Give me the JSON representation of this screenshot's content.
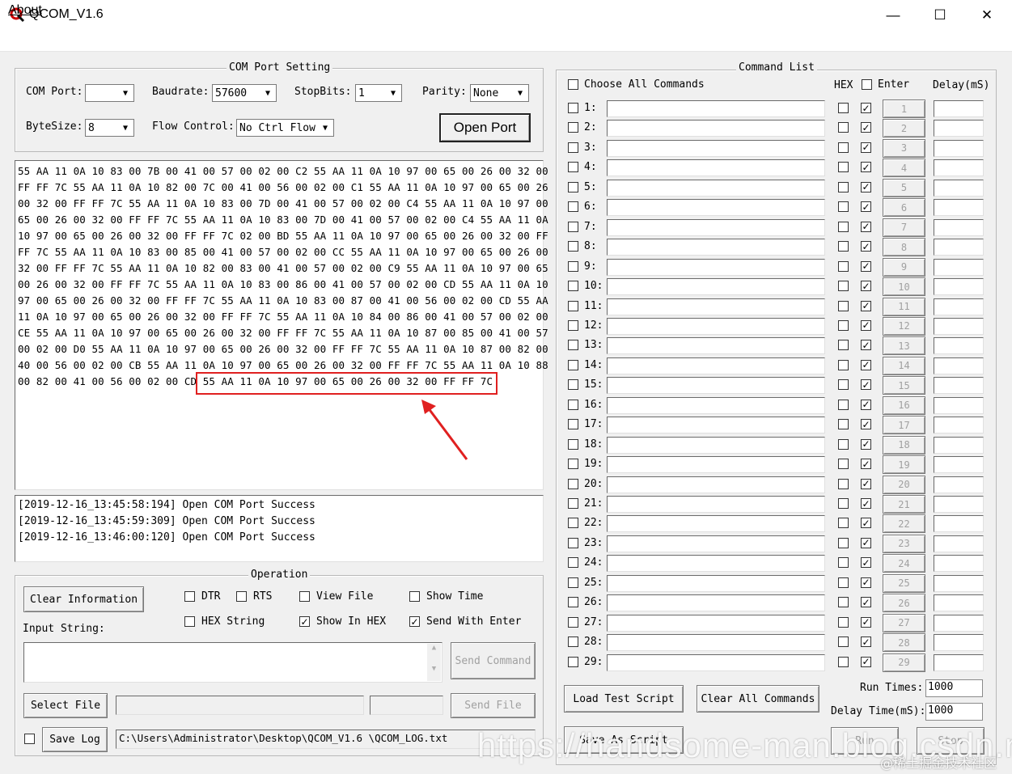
{
  "window": {
    "title": "QCOM_V1.6",
    "minimize": "—",
    "maximize": "☐",
    "close": "✕"
  },
  "menu": {
    "about": "About"
  },
  "com_setting": {
    "title": "COM Port Setting",
    "com_port_label": "COM Port:",
    "com_port_value": "",
    "baudrate_label": "Baudrate:",
    "baudrate_value": "57600",
    "stopbits_label": "StopBits:",
    "stopbits_value": "1",
    "parity_label": "Parity:",
    "parity_value": "None",
    "bytesize_label": "ByteSize:",
    "bytesize_value": "8",
    "flow_label": "Flow Control:",
    "flow_value": "No Ctrl Flow",
    "open_port": "Open Port"
  },
  "receive_lines": [
    "55 AA 11 0A 10 83 00 7B 00 41 00 57 00 02 00 C2 55 AA 11 0A 10 97 00 65 00 26 00 32 00",
    "FF FF 7C 55 AA 11 0A 10 82 00 7C 00 41 00 56 00 02 00 C1 55 AA 11 0A 10 97 00 65 00 26",
    "00 32 00 FF FF 7C 55 AA 11 0A 10 83 00 7D 00 41 00 57 00 02 00 C4 55 AA 11 0A 10 97 00",
    "65 00 26 00 32 00 FF FF 7C 55 AA 11 0A 10 83 00 7D 00 41 00 57 00 02 00 C4 55 AA 11 0A",
    "10 97 00 65 00 26 00 32 00 FF FF 7C 02 00 BD 55 AA 11 0A 10 97 00 65 00 26 00 32 00 FF",
    "FF 7C 55 AA 11 0A 10 83 00 85 00 41 00 57 00 02 00 CC 55 AA 11 0A 10 97 00 65 00 26 00",
    "32 00 FF FF 7C 55 AA 11 0A 10 82 00 83 00 41 00 57 00 02 00 C9 55 AA 11 0A 10 97 00 65",
    "00 26 00 32 00 FF FF 7C 55 AA 11 0A 10 83 00 86 00 41 00 57 00 02 00 CD 55 AA 11 0A 10",
    "97 00 65 00 26 00 32 00 FF FF 7C 55 AA 11 0A 10 83 00 87 00 41 00 56 00 02 00 CD 55 AA",
    "11 0A 10 97 00 65 00 26 00 32 00 FF FF 7C 55 AA 11 0A 10 84 00 86 00 41 00 57 00 02 00",
    "CE 55 AA 11 0A 10 97 00 65 00 26 00 32 00 FF FF 7C 55 AA 11 0A 10 87 00 85 00 41 00 57",
    "00 02 00 D0 55 AA 11 0A 10 97 00 65 00 26 00 32 00 FF FF 7C 55 AA 11 0A 10 87 00 82 00",
    "40 00 56 00 02 00 CB 55 AA 11 0A 10 97 00 65 00 26 00 32 00 FF FF 7C 55 AA 11 0A 10 88",
    "00 82 00 41 00 56 00 02 00 CD 55 AA 11 0A 10 97 00 65 00 26 00 32 00 FF FF 7C"
  ],
  "log_lines": [
    "[2019-12-16_13:45:58:194] Open COM Port Success",
    "[2019-12-16_13:45:59:309] Open COM Port Success",
    "[2019-12-16_13:46:00:120] Open COM Port Success"
  ],
  "operation": {
    "title": "Operation",
    "clear_information": "Clear Information",
    "dtr": "DTR",
    "rts": "RTS",
    "view_file": "View File",
    "show_time": "Show Time",
    "hex_string": "HEX String",
    "show_in_hex": "Show In HEX",
    "send_with_enter": "Send With Enter",
    "input_string_label": "Input String:",
    "send_command": "Send Command",
    "select_file": "Select File",
    "send_file": "Send File",
    "save_log": "Save Log",
    "log_path": "C:\\Users\\Administrator\\Desktop\\QCOM_V1.6 \\QCOM_LOG.txt"
  },
  "command_list": {
    "title": "Command List",
    "choose_all": "Choose All Commands",
    "hex_header": "HEX",
    "enter_header": "Enter",
    "delay_header": "Delay(mS)",
    "load_test_script": "Load Test Script",
    "clear_all_commands": "Clear All Commands",
    "save_as_script": "Save As Script",
    "run_times_label": "Run Times:",
    "run_times_value": "1000",
    "delay_time_label": "Delay Time(mS):",
    "delay_time_value": "1000",
    "run": "Run",
    "stop": "Stop"
  },
  "watermark": {
    "url": "https://handsome-man.blog.csdn.net",
    "site": "@稀土掘金技术社区"
  },
  "colors": {
    "highlight_box": "#e02020",
    "arrow": "#e02020"
  }
}
